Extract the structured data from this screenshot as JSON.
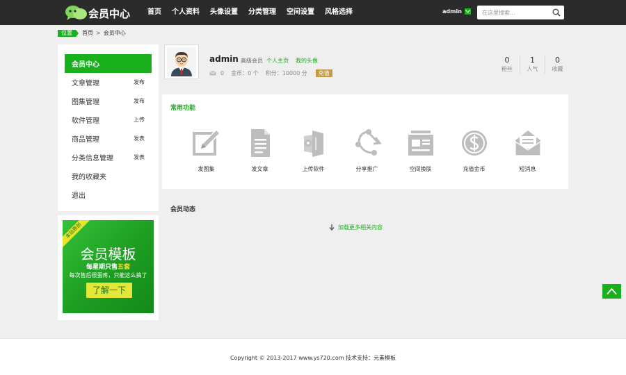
{
  "header": {
    "logo_text": "会员中心",
    "nav": [
      "首页",
      "个人资料",
      "头像设置",
      "分类管理",
      "空间设置",
      "风格选择"
    ],
    "user": "admin",
    "search_placeholder": "在这里搜索..."
  },
  "breadcrumb": {
    "tag": "位置",
    "home": "首页",
    "sep": ">",
    "current": "会员中心"
  },
  "sidebar": {
    "items": [
      {
        "label": "会员中心",
        "tag": ""
      },
      {
        "label": "文章管理",
        "tag": "发布"
      },
      {
        "label": "图集管理",
        "tag": "发布"
      },
      {
        "label": "软件管理",
        "tag": "上传"
      },
      {
        "label": "商品管理",
        "tag": "发表"
      },
      {
        "label": "分类信息管理",
        "tag": "发表"
      },
      {
        "label": "我的收藏夹",
        "tag": ""
      },
      {
        "label": "退出",
        "tag": ""
      }
    ]
  },
  "promo": {
    "ribbon": "本站原创",
    "title": "会员模板",
    "line1_prefix": "每星期只售",
    "line1_highlight": "五套",
    "line2": "每次售后很蛋疼，只能这么搞了",
    "button": "了解一下"
  },
  "profile": {
    "username": "admin",
    "level": "高级会员",
    "link_home": "个人主页",
    "link_avatar": "我的头像",
    "messages": "0",
    "coins": "金币：0 个",
    "points": "积分：10000 分",
    "recharge": "充值",
    "stats": [
      {
        "num": "0",
        "label": "粉丝"
      },
      {
        "num": "1",
        "label": "人气"
      },
      {
        "num": "0",
        "label": "收藏"
      }
    ]
  },
  "functions": {
    "title": "常用功能",
    "items": [
      {
        "label": "发图集",
        "icon": "edit-icon"
      },
      {
        "label": "发文章",
        "icon": "document-icon"
      },
      {
        "label": "上传软件",
        "icon": "software-icon"
      },
      {
        "label": "分享推广",
        "icon": "share-icon"
      },
      {
        "label": "空间换肤",
        "icon": "skin-icon"
      },
      {
        "label": "充值金币",
        "icon": "coin-icon"
      },
      {
        "label": "短消息",
        "icon": "envelope-icon"
      }
    ]
  },
  "dynamics": {
    "title": "会员动态",
    "load_more": "加载更多相关内容"
  },
  "footer": {
    "copyright": "Copyright © 2013-2017 www.ys720.com 技术支持：元素模板"
  },
  "colors": {
    "accent": "#19b01e",
    "header_bg": "#2b2b2b",
    "recharge": "#c59a44"
  }
}
